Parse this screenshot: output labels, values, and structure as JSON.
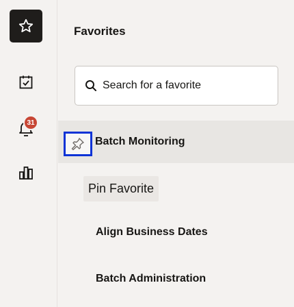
{
  "rail": {
    "items": [
      {
        "icon": "star-icon",
        "active": true
      },
      {
        "icon": "calendar-check-icon",
        "active": false
      },
      {
        "icon": "bell-icon",
        "active": false,
        "badge": "31"
      },
      {
        "icon": "bar-chart-icon",
        "active": false
      }
    ],
    "badge_color": "#c74634"
  },
  "panel": {
    "title": "Favorites",
    "search": {
      "placeholder": "Search for a favorite",
      "value": ""
    },
    "favorites": [
      {
        "label": "Batch Monitoring",
        "pin_tooltip": "Pin Favorite"
      }
    ],
    "items": [
      {
        "label": "Align Business Dates"
      },
      {
        "label": "Batch Administration"
      }
    ]
  },
  "colors": {
    "focus_ring": "#0b33d6",
    "active_rail": "#1f1d1b"
  }
}
